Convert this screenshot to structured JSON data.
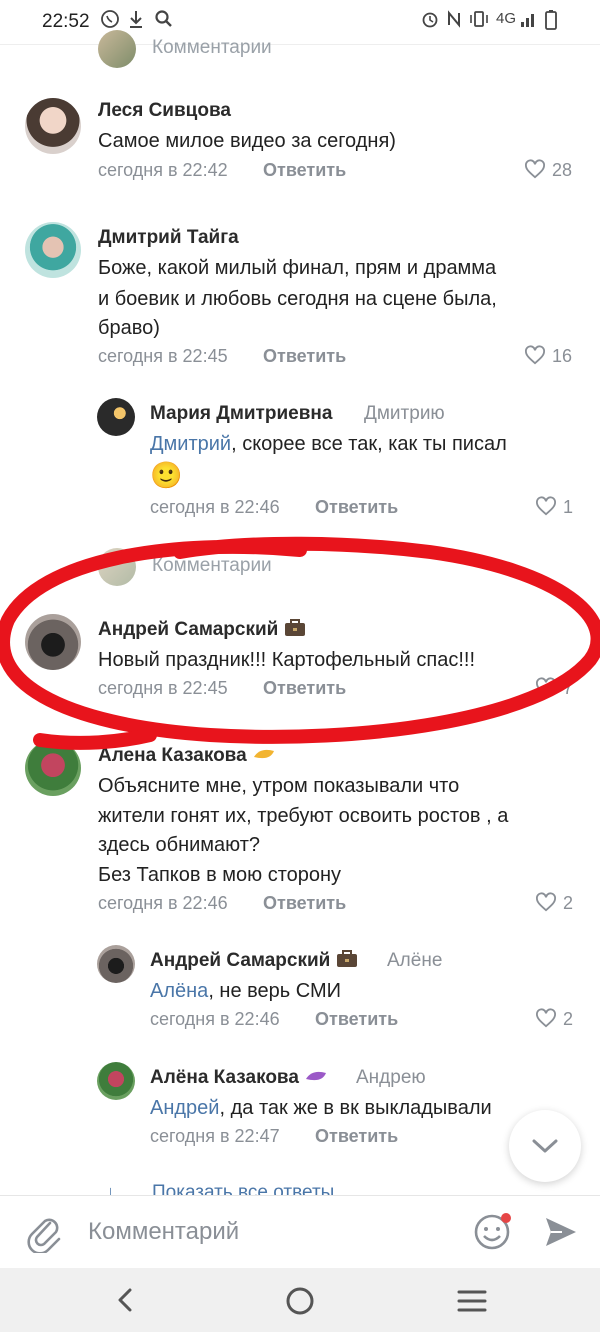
{
  "status_bar": {
    "time": "22:52",
    "network": "4G"
  },
  "prev_comments_label": "Комментарии",
  "comments": [
    {
      "name": "Леся Сивцова",
      "text": "Самое милое видео за сегодня)",
      "time": "сегодня в 22:42",
      "reply": "Ответить",
      "likes": "28"
    },
    {
      "name": "Дмитрий Тайга",
      "text_lines": [
        "Боже, какой милый финал, прям и драмма",
        "и боевик и любовь сегодня на сцене была,",
        "браво)"
      ],
      "time": "сегодня в 22:45",
      "reply": "Ответить",
      "likes": "16"
    },
    {
      "name": "Мария Дмитриевна",
      "reply_to": "Дмитрию",
      "mention": "Дмитрий",
      "text_rest": ", скорее все так, как ты писал",
      "emoji": "🙂",
      "time": "сегодня в 22:46",
      "reply": "Ответить",
      "likes": "1"
    },
    {
      "name": "Андрей Самарский",
      "text": "Новый праздник!!! Картофельный спас!!!",
      "time": "сегодня в 22:45",
      "reply": "Ответить",
      "likes": "7"
    },
    {
      "name": "Алена Казакова",
      "text_lines": [
        "Объясните мне, утром показывали что",
        "жители гонят их, требуют освоить ростов , а",
        "здесь обнимают?",
        "Без Тапков в мою сторону"
      ],
      "time": "сегодня в 22:46",
      "reply": "Ответить",
      "likes": "2"
    },
    {
      "name": "Андрей Самарский",
      "reply_to": "Алёне",
      "mention": "Алёна",
      "text_rest": ", не верь СМИ",
      "time": "сегодня в 22:46",
      "reply": "Ответить",
      "likes": "2"
    },
    {
      "name": "Алёна Казакова",
      "reply_to": "Андрею",
      "mention": "Андрей",
      "text_rest": ", да так же в вк выкладывали",
      "time": "сегодня в 22:47",
      "reply": "Ответить"
    }
  ],
  "show_all_replies": "Показать все ответы",
  "composer": {
    "placeholder": "Комментарий"
  },
  "colors": {
    "link": "#4a76a8",
    "muted": "#8a8f96",
    "annotation": "#e8141c"
  }
}
